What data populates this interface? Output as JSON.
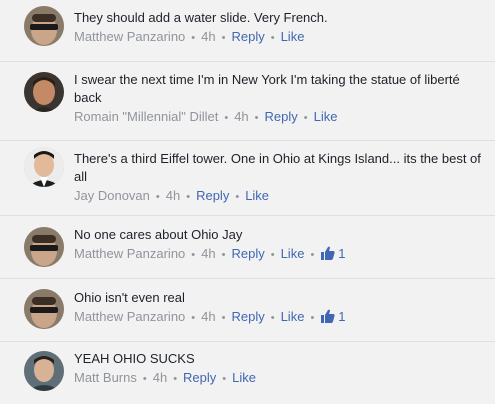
{
  "comments": [
    {
      "text": "They should add a water slide. Very French.",
      "author": "Matthew Panzarino",
      "time": "4h",
      "reply_label": "Reply",
      "like_label": "Like",
      "avatar": "matthew-panzarino-avatar"
    },
    {
      "text": "I swear the next time I'm in New York I'm taking the statue of liberté back",
      "author": "Romain \"Millennial\" Dillet",
      "time": "4h",
      "reply_label": "Reply",
      "like_label": "Like",
      "avatar": "romain-dillet-avatar"
    },
    {
      "text": "There's a third Eiffel tower. One in Ohio at Kings Island... its the best of all",
      "author": "Jay Donovan",
      "time": "4h",
      "reply_label": "Reply",
      "like_label": "Like",
      "avatar": "jay-donovan-avatar"
    },
    {
      "text": "No one cares about Ohio Jay",
      "author": "Matthew Panzarino",
      "time": "4h",
      "reply_label": "Reply",
      "like_label": "Like",
      "like_count": "1",
      "avatar": "matthew-panzarino-avatar"
    },
    {
      "text": "Ohio isn't even real",
      "author": "Matthew Panzarino",
      "time": "4h",
      "reply_label": "Reply",
      "like_label": "Like",
      "like_count": "1",
      "avatar": "matthew-panzarino-avatar"
    },
    {
      "text": "YEAH OHIO SUCKS",
      "author": "Matt Burns",
      "time": "4h",
      "reply_label": "Reply",
      "like_label": "Like",
      "avatar": "matt-burns-avatar"
    }
  ],
  "separator": "•",
  "colors": {
    "background": "#f2f2f2",
    "link": "#4267b2",
    "meta": "#90949c",
    "text": "#1d2129"
  }
}
